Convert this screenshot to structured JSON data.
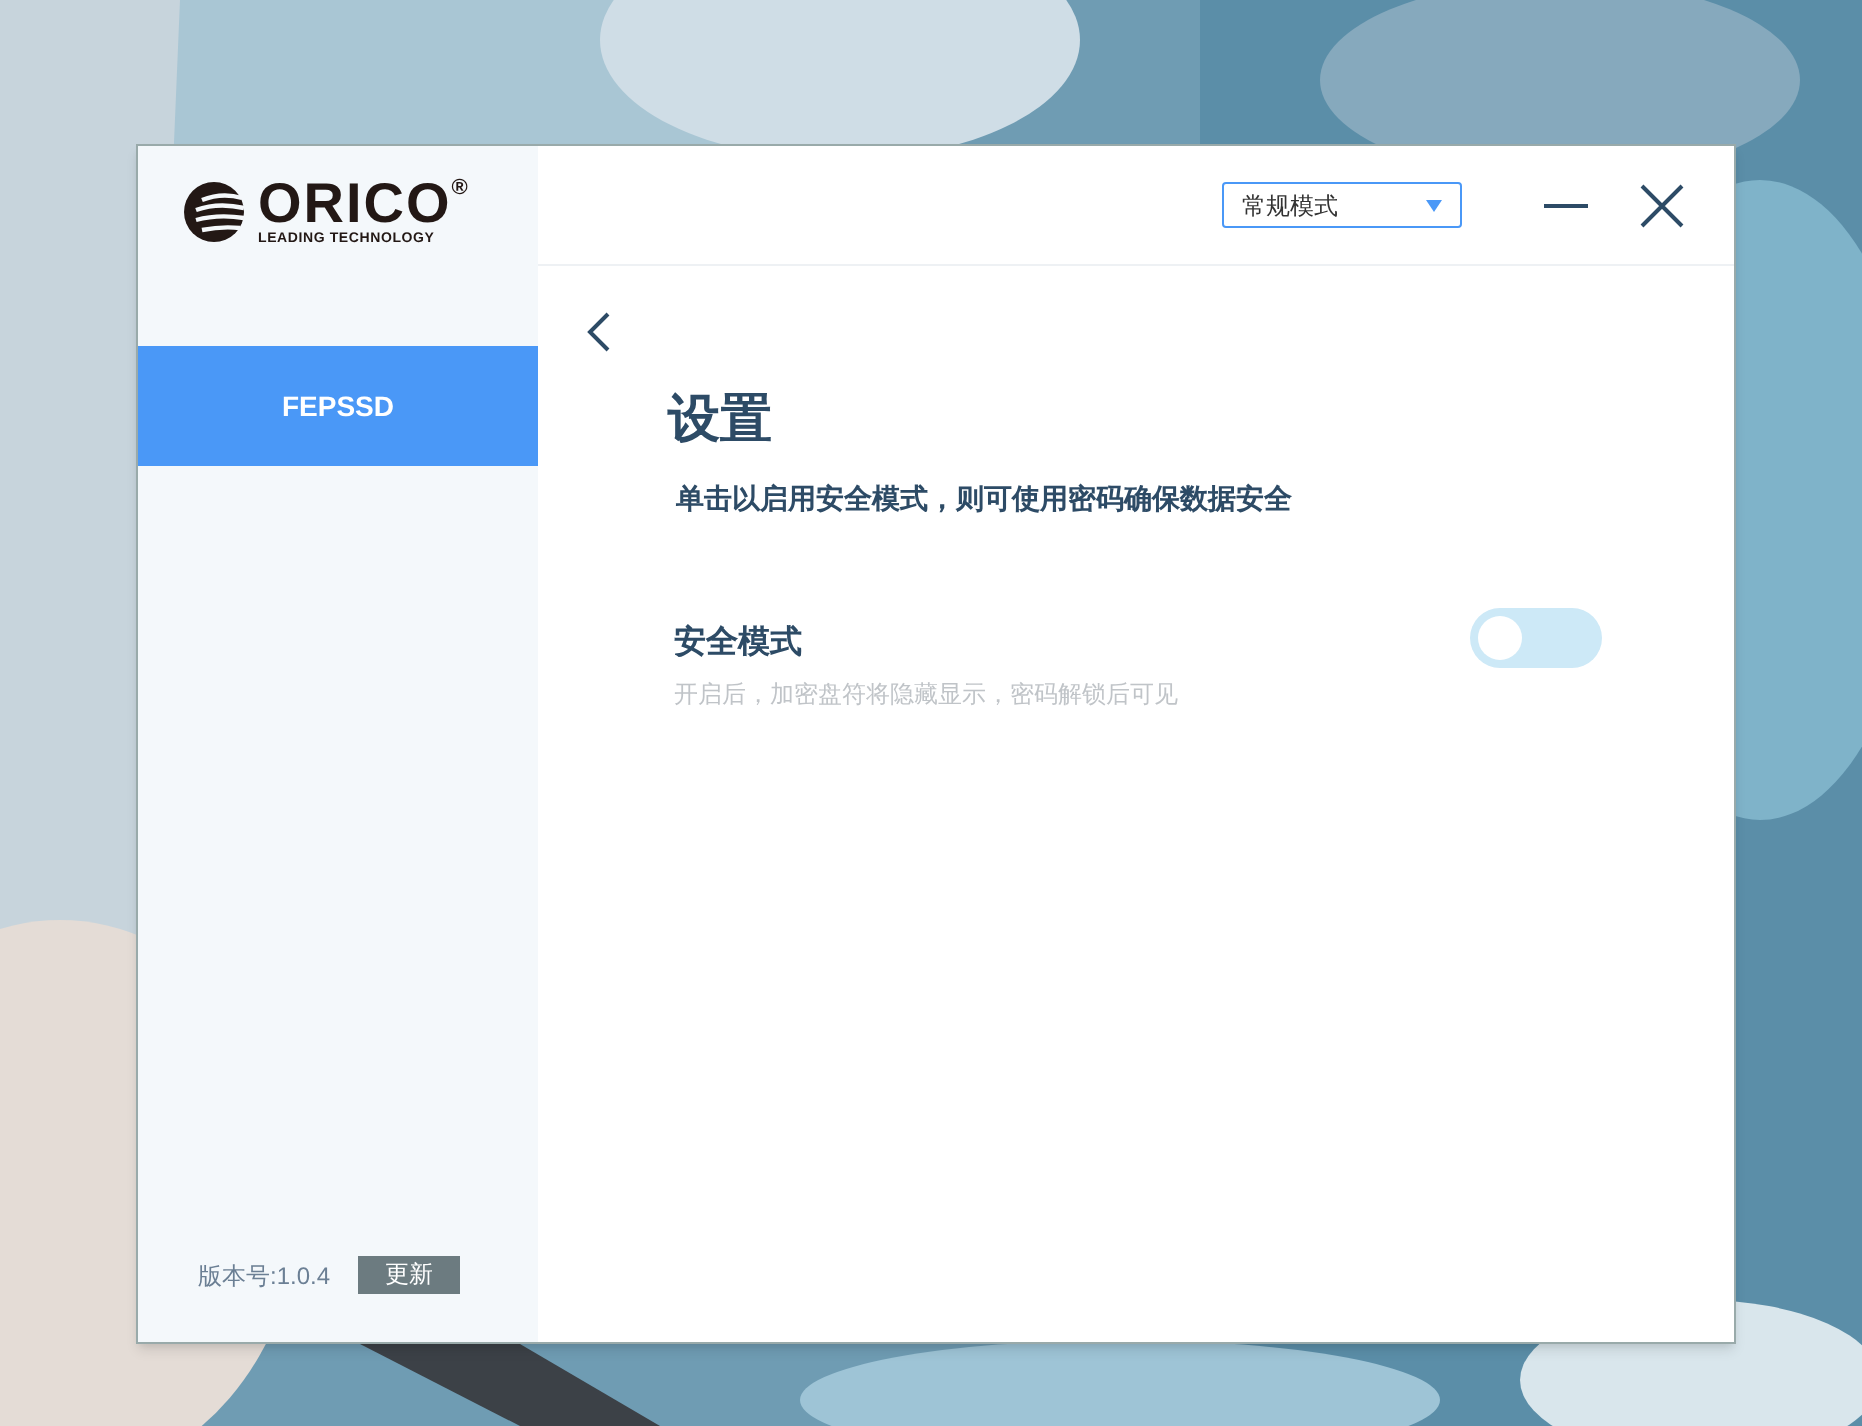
{
  "logo": {
    "name": "ORICO",
    "mark": "®",
    "tagline": "LEADING TECHNOLOGY"
  },
  "sidebar": {
    "items": [
      {
        "label": "FEPSSD",
        "selected": true
      }
    ],
    "version": "版本号:1.0.4",
    "update_button": "更新"
  },
  "header": {
    "mode_select": {
      "value": "常规模式"
    }
  },
  "settings": {
    "title": "设置",
    "description": "单击以启用安全模式，则可使用密码确保数据安全",
    "options": [
      {
        "label": "安全模式",
        "hint": "开启后，加密盘符将隐藏显示，密码解锁后可见",
        "on": false
      }
    ]
  }
}
